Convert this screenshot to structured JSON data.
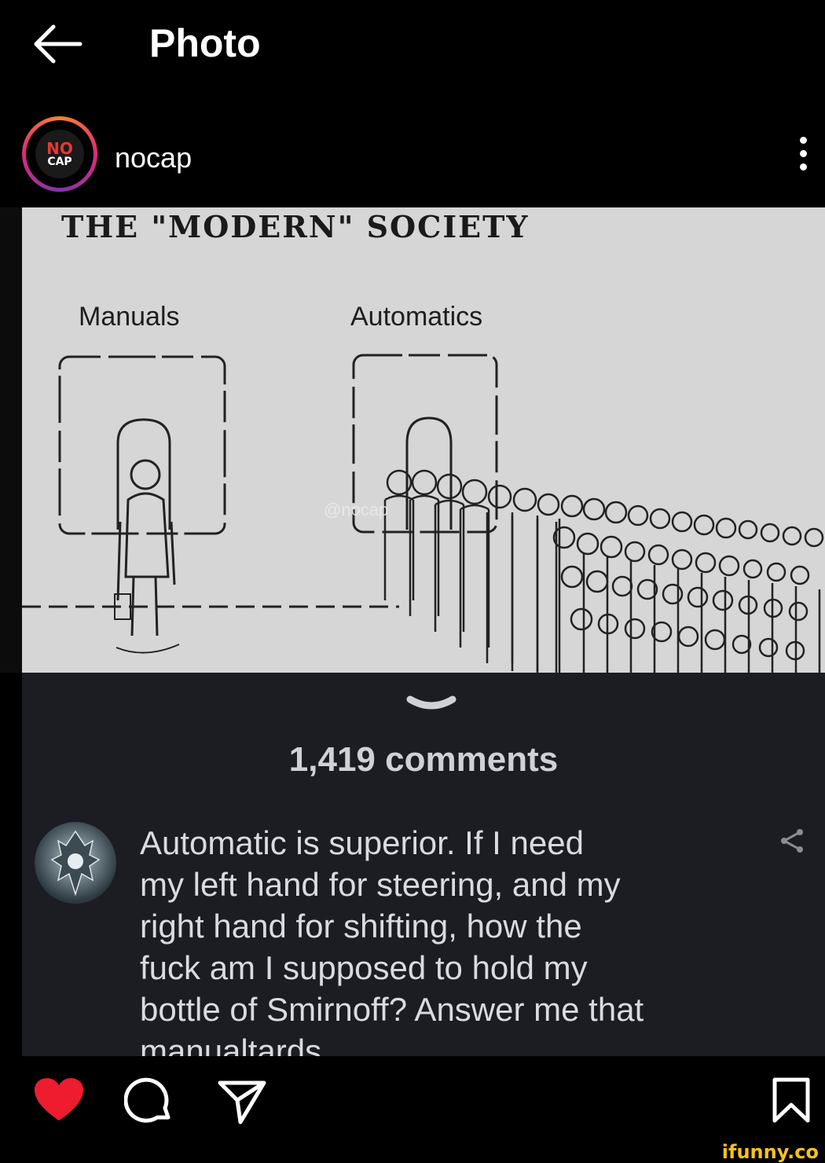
{
  "header": {
    "title": "Photo"
  },
  "account": {
    "username": "nocap",
    "avatar_logo_top": "NO",
    "avatar_logo_bottom": "CAP"
  },
  "post": {
    "meme_title": "THE \"MODERN\" SOCIETY",
    "label_left": "Manuals",
    "label_right": "Automatics",
    "watermark": "@nocap"
  },
  "comments": {
    "count_label": "1,419 comments",
    "top_comment": {
      "text": "Automatic is superior. If I need\nmy left hand for steering, and my\nright hand for shifting, how the\nfuck am I supposed to hold my\nbottle of Smirnoff? Answer me that\nmanualtards"
    }
  },
  "bottom_bar": {
    "icons": [
      "heart-icon",
      "comment-icon",
      "share-icon",
      "bookmark-icon"
    ]
  },
  "site_watermark": "ifunny.co",
  "colors": {
    "like": "#ed1c2e",
    "background": "#000000",
    "comments_bg": "#1b1d22"
  }
}
